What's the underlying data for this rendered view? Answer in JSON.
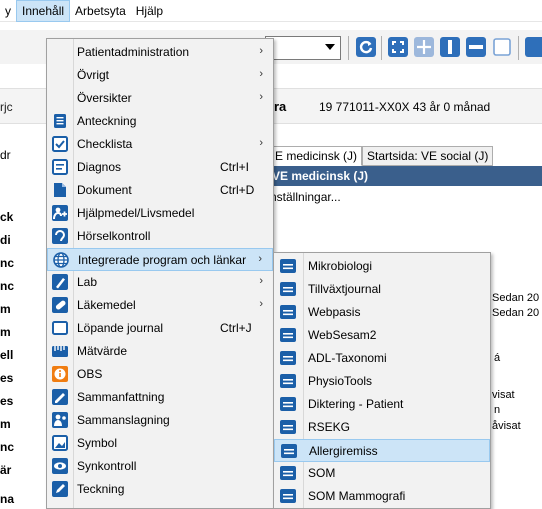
{
  "menubar": {
    "items": [
      {
        "label": "y"
      },
      {
        "label": "Innehåll",
        "active": true
      },
      {
        "label": "Arbetsyta"
      },
      {
        "label": "Hjälp"
      }
    ]
  },
  "patient": {
    "name_fragment": "ra",
    "id_age": "19 771011-XX0X  43 år 0 månad",
    "left_fragment": "rjc"
  },
  "tabs": {
    "left_fragment": "dr",
    "items": [
      "E medicinsk (J)",
      "Startsida: VE social (J)"
    ],
    "panel_header": "VE medicinsk (J)",
    "settings_link": "nställningar..."
  },
  "left_fragments": [
    "ck",
    "di",
    "nc",
    "nc",
    "m",
    "m",
    "ell",
    "es",
    "es",
    "m",
    "nc",
    "är",
    "",
    "na"
  ],
  "right_fragments": [
    "Sedan 20",
    "Sedan 20",
    "á",
    "visat",
    "n",
    "åvisat"
  ],
  "main_menu": {
    "items": [
      {
        "label": "Patientadministration",
        "submenu": true,
        "icon": "none"
      },
      {
        "label": "Övrigt",
        "submenu": true,
        "icon": "none"
      },
      {
        "label": "Översikter",
        "submenu": true,
        "icon": "none"
      },
      {
        "label": "Anteckning",
        "icon": "note-icon"
      },
      {
        "label": "Checklista",
        "submenu": true,
        "icon": "checklist-icon"
      },
      {
        "label": "Diagnos",
        "shortcut": "Ctrl+I",
        "icon": "diagnosis-icon"
      },
      {
        "label": "Dokument",
        "shortcut": "Ctrl+D",
        "icon": "document-icon"
      },
      {
        "label": "Hjälpmedel/Livsmedel",
        "icon": "aid-icon"
      },
      {
        "label": "Hörselkontroll",
        "icon": "hearing-icon"
      },
      {
        "label": "Integrerade program och länkar",
        "submenu": true,
        "icon": "globe-icon",
        "highlighted": true
      },
      {
        "label": "Lab",
        "submenu": true,
        "icon": "lab-icon"
      },
      {
        "label": "Läkemedel",
        "submenu": true,
        "icon": "medication-icon"
      },
      {
        "label": "Löpande journal",
        "shortcut": "Ctrl+J",
        "icon": "journal-icon"
      },
      {
        "label": "Mätvärde",
        "icon": "measurement-icon"
      },
      {
        "label": "OBS",
        "icon": "obs-icon"
      },
      {
        "label": "Sammanfattning",
        "icon": "summary-icon"
      },
      {
        "label": "Sammanslagning",
        "icon": "merge-icon"
      },
      {
        "label": "Symbol",
        "icon": "symbol-icon"
      },
      {
        "label": "Synkontroll",
        "icon": "eye-icon"
      },
      {
        "label": "Teckning",
        "icon": "drawing-icon"
      }
    ]
  },
  "sub_menu": {
    "items": [
      {
        "label": "Mikrobiologi"
      },
      {
        "label": "Tillväxtjournal"
      },
      {
        "label": "Webpasis"
      },
      {
        "label": "WebSesam2"
      },
      {
        "label": "ADL-Taxonomi"
      },
      {
        "label": "PhysioTools"
      },
      {
        "label": "Diktering - Patient"
      },
      {
        "label": "RSEKG"
      },
      {
        "label": "Allergiremiss",
        "highlighted": true
      },
      {
        "label": "SOM"
      },
      {
        "label": "SOM Mammografi"
      }
    ]
  },
  "colors": {
    "menu_bg": "#f2f2f2",
    "highlight": "#cce4f7",
    "highlight_border": "#99c9ef",
    "icon_blue": "#1b5fa8",
    "icon_orange": "#f07d12",
    "panel_header": "#3a5f8c",
    "toolbar_icon": "#2e6fba"
  }
}
